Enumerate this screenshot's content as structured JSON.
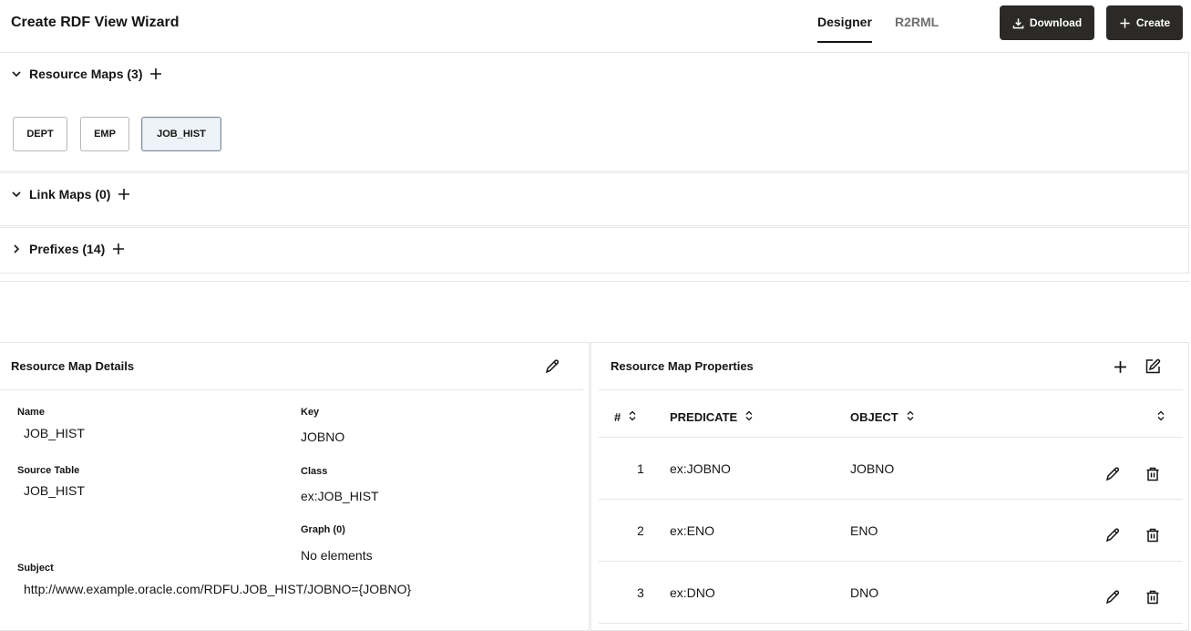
{
  "header": {
    "title": "Create RDF View Wizard",
    "tabs": [
      {
        "label": "Designer",
        "active": true
      },
      {
        "label": "R2RML",
        "active": false
      }
    ],
    "download_label": "Download",
    "create_label": "Create"
  },
  "sections": {
    "resource_maps": {
      "label": "Resource Maps (3)",
      "expanded": true,
      "items": [
        "DEPT",
        "EMP",
        "JOB_HIST"
      ],
      "selected": "JOB_HIST"
    },
    "link_maps": {
      "label": "Link Maps (0)",
      "expanded": true
    },
    "prefixes": {
      "label": "Prefixes (14)",
      "expanded": false
    }
  },
  "details": {
    "title": "Resource Map Details",
    "name_label": "Name",
    "name_value": "JOB_HIST",
    "key_label": "Key",
    "key_value": "JOBNO",
    "source_label": "Source Table",
    "source_value": "JOB_HIST",
    "class_label": "Class",
    "class_value": "ex:JOB_HIST",
    "graph_label": "Graph (0)",
    "graph_value": "No elements",
    "subject_label": "Subject",
    "subject_value": "http://www.example.oracle.com/RDFU.JOB_HIST/JOBNO={JOBNO}"
  },
  "properties": {
    "title": "Resource Map Properties",
    "columns": [
      "#",
      "PREDICATE",
      "OBJECT"
    ],
    "rows": [
      {
        "num": "1",
        "predicate": "ex:JOBNO",
        "object": "JOBNO"
      },
      {
        "num": "2",
        "predicate": "ex:ENO",
        "object": "ENO"
      },
      {
        "num": "3",
        "predicate": "ex:DNO",
        "object": "DNO"
      }
    ]
  },
  "colors": {
    "primary_button": "#2b2a28",
    "selected_chip_bg": "#edf3f9",
    "border": "#e6e6e4"
  }
}
